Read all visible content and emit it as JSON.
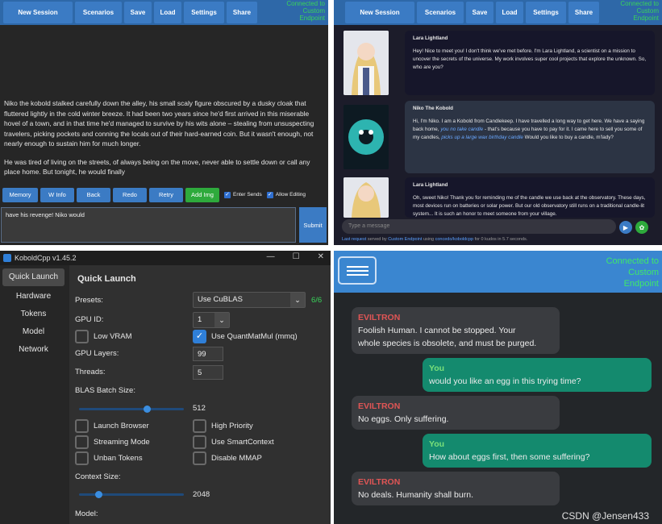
{
  "lite": {
    "nav": [
      "New Session",
      "Scenarios",
      "Save",
      "Load",
      "Settings",
      "Share"
    ],
    "connection": [
      "Connected to",
      "Custom",
      "Endpoint"
    ]
  },
  "story": {
    "para1": "Niko the kobold stalked carefully down the alley, his small scaly figure obscured by a dusky cloak that fluttered lightly in the cold winter breeze. It had been two years since he'd first arrived in this miserable hovel of a town, and in that time he'd managed to survive by his wits alone – stealing from unsuspecting travelers, picking pockets and conning the locals out of their hard-earned coin. But it wasn't enough, not nearly enough to sustain him for much longer.",
    "para2": "He was tired of living on the streets, of always being on the move, never able to settle down or call any place home. But tonight, he would finally",
    "toolbar": [
      "Memory",
      "W Info",
      "Back",
      "Redo",
      "Retry",
      "Add Img"
    ],
    "enter_sends": "Enter Sends",
    "allow_editing": "Allow Editing",
    "input_value": "have his revenge! Niko would",
    "submit": "Submit"
  },
  "chat": {
    "m1_name": "Lara Lightland",
    "m1_text": "Hey! Nice to meet you! I don't think we've met before. I'm Lara Lightland, a scientist on a mission to uncover the secrets of the universe. My work involves super cool projects that explore the unknown. So, who are you?",
    "m2_name": "Niko The Kobold",
    "m2_a": "Hi, I'm Niko. I am a Kobold from Candlekeep. I have travelled a long way to get here. We have a saying back home,",
    "m2_hl1": "you no take candle",
    "m2_b": "- that's because you have to pay for it. I came here to sell you some of my candles,",
    "m2_hl2": "picks up a large wax birthday candle",
    "m2_c": "Would you like to buy a candle, m'lady?",
    "m3_name": "Lara Lightland",
    "m3_text": "Oh, sweet Niko! Thank you for reminding me of the candle we use back at the observatory. These days, most devices run on batteries or solar power. But our old observatory still runs on a traditional candle-lit system... It is such an honor to meet someone from your village.",
    "placeholder": "Type a message",
    "foot_a": "Last request",
    "foot_b": "served by",
    "foot_c": "Custom Endpoint",
    "foot_d": "using",
    "foot_e": "concedo/koboldcpp",
    "foot_f": "for 0 kudos in 5.7 seconds."
  },
  "kcpp": {
    "title": "KoboldCpp v1.45.2",
    "side": [
      "Quick Launch",
      "Hardware",
      "Tokens",
      "Model",
      "Network"
    ],
    "heading": "Quick Launch",
    "presets_label": "Presets:",
    "presets_value": "Use CuBLAS",
    "presets_count": "6/6",
    "gpuid_label": "GPU ID:",
    "gpuid_value": "1",
    "lowvram": "Low VRAM",
    "quantmatmul": "Use QuantMatMul (mmq)",
    "gpulayers_label": "GPU Layers:",
    "gpulayers_value": "99",
    "threads_label": "Threads:",
    "threads_value": "5",
    "blas_label": "BLAS Batch Size:",
    "blas_value": "512",
    "launch_browser": "Launch Browser",
    "high_priority": "High Priority",
    "streaming": "Streaming Mode",
    "smartcontext": "Use SmartContext",
    "unban": "Unban Tokens",
    "disable_mmap": "Disable MMAP",
    "ctx_label": "Context Size:",
    "ctx_value": "2048",
    "model_label": "Model:"
  },
  "evil": {
    "connection": [
      "Connected to",
      "Custom",
      "Endpoint"
    ],
    "msgs": [
      {
        "who": "EVILTRON",
        "text1": "Foolish Human. I cannot be stopped. Your",
        "text2": "whole species is obsolete, and must be purged."
      },
      {
        "who": "You",
        "text1": "would you like an egg in this trying time?"
      },
      {
        "who": "EVILTRON",
        "text1": "No eggs. Only suffering."
      },
      {
        "who": "You",
        "text1": "How about eggs first, then some suffering?"
      },
      {
        "who": "EVILTRON",
        "text1": "No deals. Humanity shall burn."
      }
    ]
  },
  "watermark": "CSDN @Jensen433"
}
